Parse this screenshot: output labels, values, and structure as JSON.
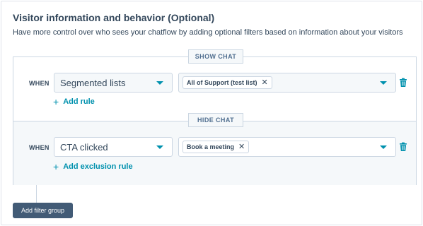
{
  "panel": {
    "title": "Visitor information and behavior (Optional)",
    "description": "Have more control over who sees your chatflow by adding optional filters based on information about your visitors"
  },
  "show_chat": {
    "label": "SHOW CHAT",
    "when": "WHEN",
    "property": "Segmented lists",
    "values": [
      "All of Support (test list)"
    ],
    "add_label": "Add rule"
  },
  "hide_chat": {
    "label": "HIDE CHAT",
    "when": "WHEN",
    "property": "CTA clicked",
    "values": [
      "Book a meeting"
    ],
    "add_label": "Add exclusion rule"
  },
  "tag_remove_glyph": "✕",
  "plus_glyph": "+",
  "footer": {
    "add_filter_group_label": "Add filter group"
  },
  "colors": {
    "accent": "#0091ae",
    "primary_button": "#425b76",
    "border": "#cbd6e2",
    "text": "#33475b"
  },
  "icons": {
    "dropdown": "caret-down-icon",
    "remove_tag": "close-icon",
    "delete_rule": "trash-icon",
    "add": "plus-icon"
  }
}
